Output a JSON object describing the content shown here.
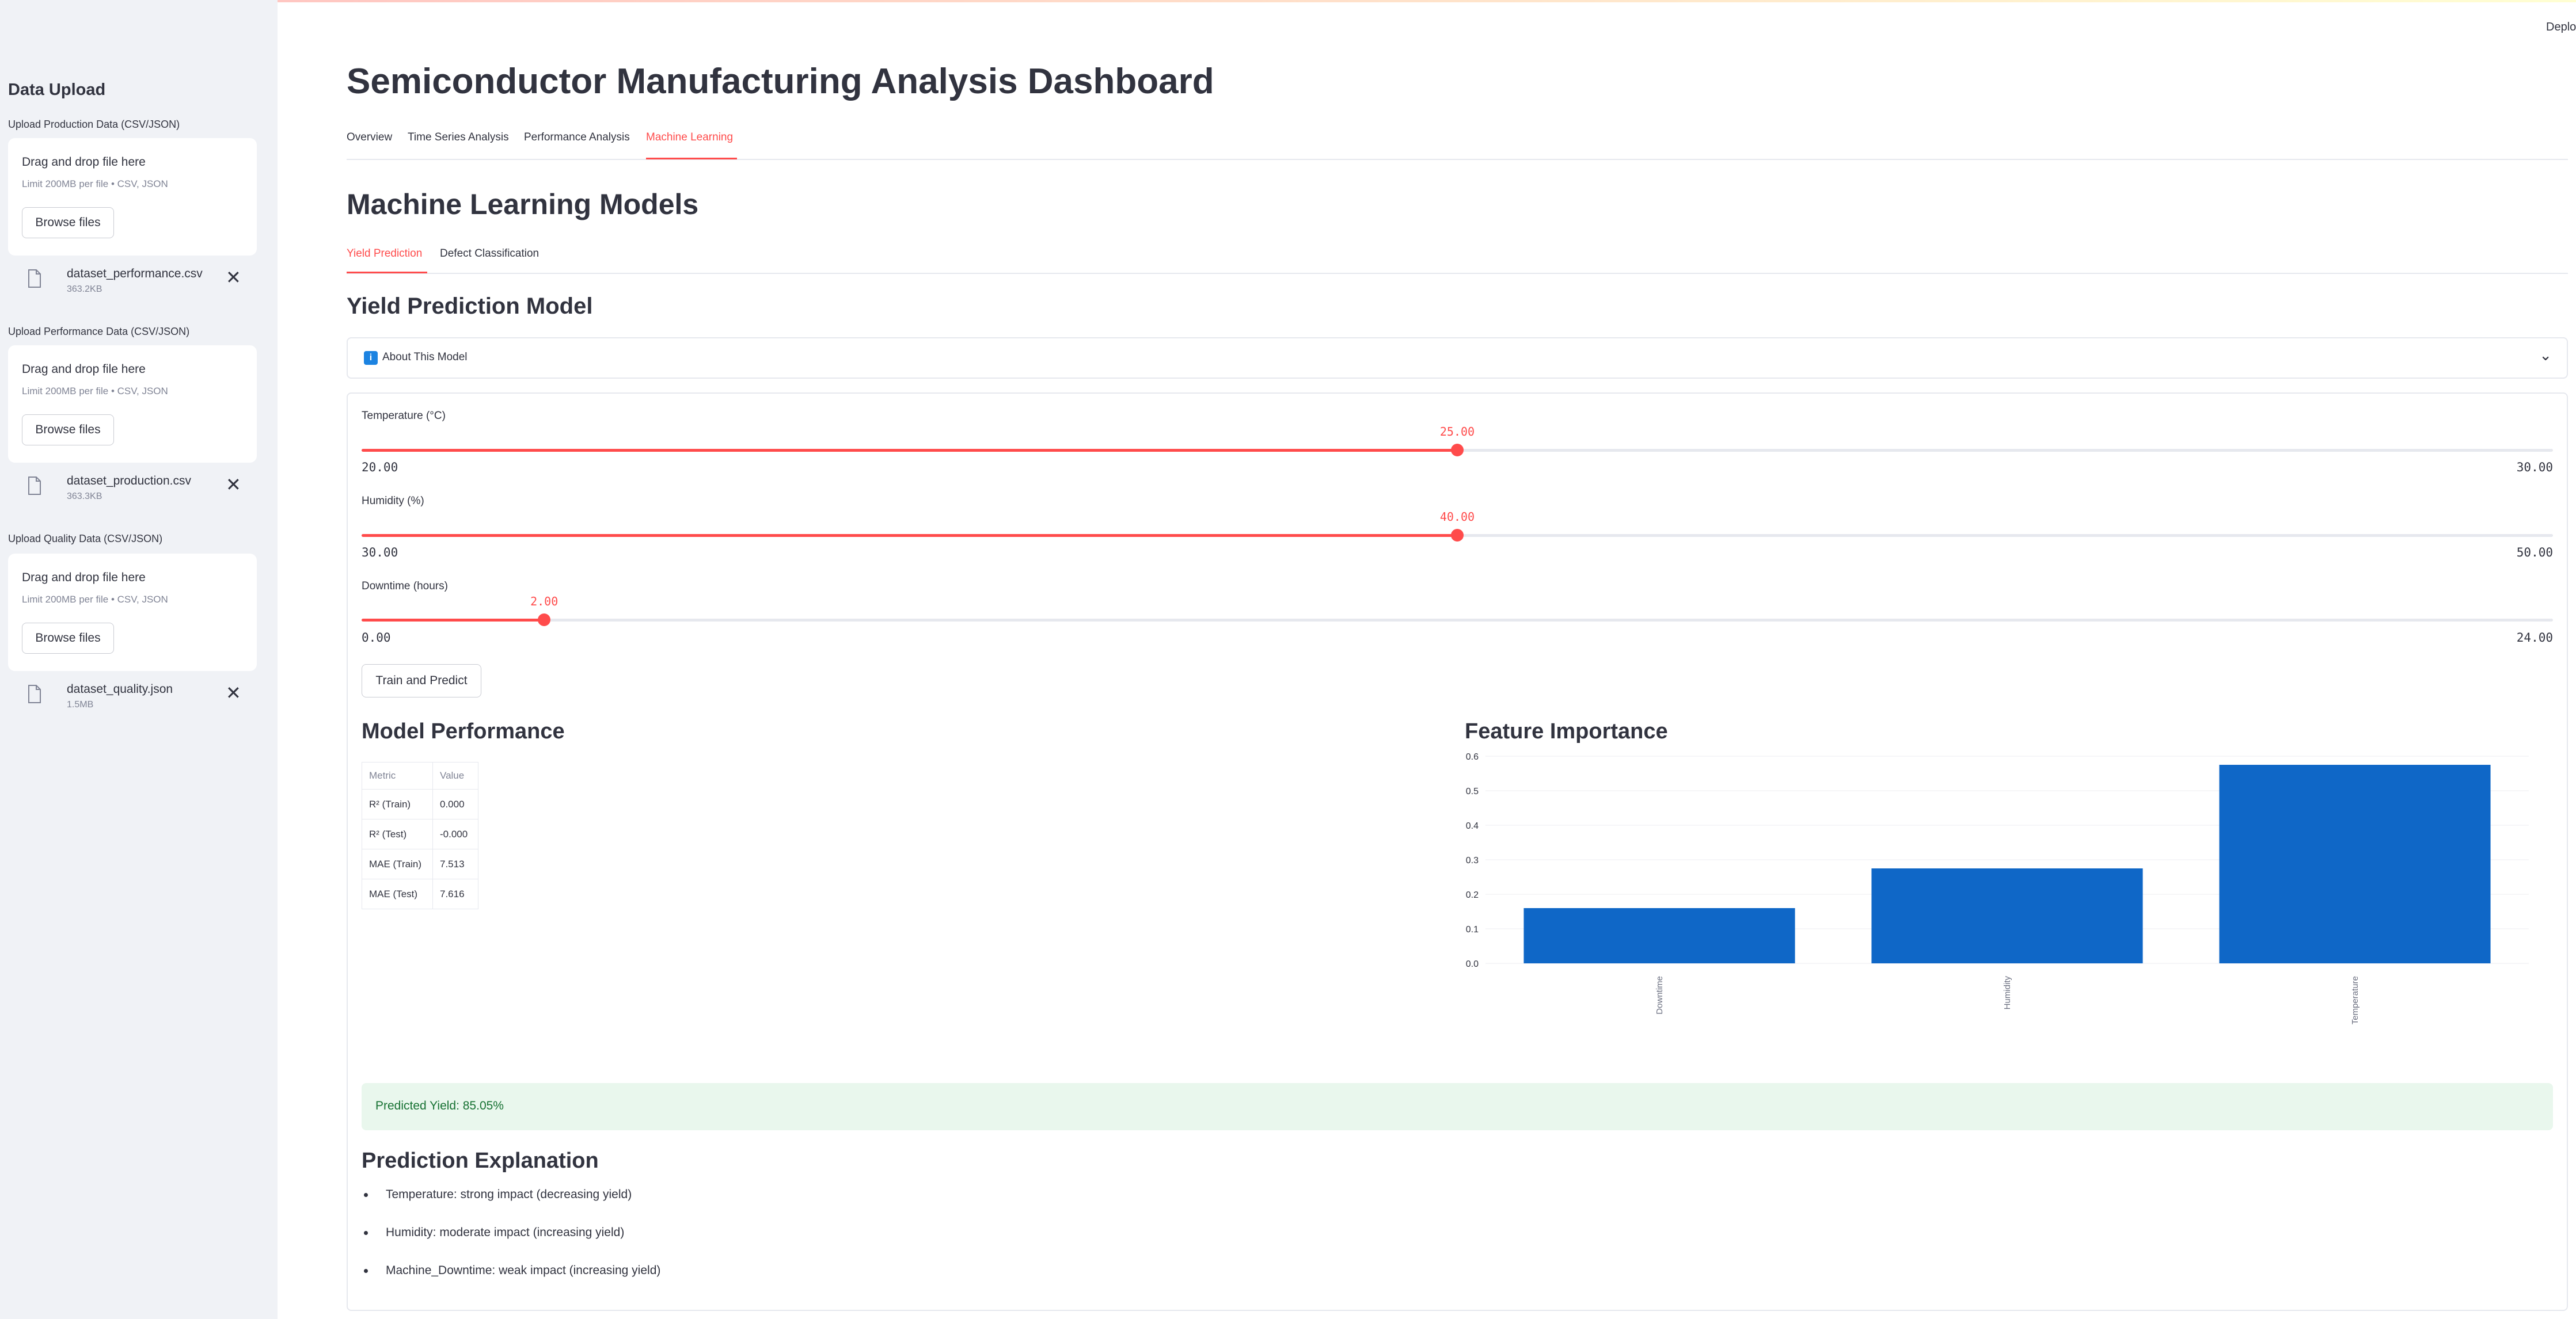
{
  "sidebar": {
    "title": "Data Upload",
    "uploaders": [
      {
        "label": "Upload Production Data (CSV/JSON)",
        "drop_text": "Drag and drop file here",
        "limit": "Limit 200MB per file • CSV, JSON",
        "browse": "Browse files",
        "file_name": "dataset_performance.csv",
        "file_size": "363.2KB"
      },
      {
        "label": "Upload Performance Data (CSV/JSON)",
        "drop_text": "Drag and drop file here",
        "limit": "Limit 200MB per file • CSV, JSON",
        "browse": "Browse files",
        "file_name": "dataset_production.csv",
        "file_size": "363.3KB"
      },
      {
        "label": "Upload Quality Data (CSV/JSON)",
        "drop_text": "Drag and drop file here",
        "limit": "Limit 200MB per file • CSV, JSON",
        "browse": "Browse files",
        "file_name": "dataset_quality.json",
        "file_size": "1.5MB"
      }
    ],
    "remove_icon": "✕"
  },
  "header": {
    "deploy": "Deplo"
  },
  "main": {
    "title": "Semiconductor Manufacturing Analysis Dashboard",
    "tabs": [
      {
        "label": "Overview"
      },
      {
        "label": "Time Series Analysis"
      },
      {
        "label": "Performance Analysis"
      },
      {
        "label": "Machine Learning",
        "active": true
      }
    ],
    "section_title": "Machine Learning Models",
    "subtabs": [
      {
        "label": "Yield Prediction",
        "active": true
      },
      {
        "label": "Defect Classification"
      }
    ],
    "model_title": "Yield Prediction Model",
    "expander": {
      "icon": "info-icon",
      "icon_glyph": "i",
      "label": "About This Model",
      "chevron": "⌄"
    }
  },
  "form": {
    "sliders": [
      {
        "label": "Temperature (°C)",
        "min": 20.0,
        "max": 30.0,
        "value": 25.0,
        "min_text": "20.00",
        "max_text": "30.00",
        "value_text": "25.00"
      },
      {
        "label": "Humidity (%)",
        "min": 30.0,
        "max": 50.0,
        "value": 40.0,
        "min_text": "30.00",
        "max_text": "50.00",
        "value_text": "40.00"
      },
      {
        "label": "Downtime (hours)",
        "min": 0.0,
        "max": 24.0,
        "value": 2.0,
        "min_text": "0.00",
        "max_text": "24.00",
        "value_text": "2.00"
      }
    ],
    "train_button": "Train and Predict",
    "model_performance_title": "Model Performance",
    "metrics": {
      "headers": [
        "Metric",
        "Value"
      ],
      "rows": [
        [
          "R² (Train)",
          "0.000"
        ],
        [
          "R² (Test)",
          "-0.000"
        ],
        [
          "MAE (Train)",
          "7.513"
        ],
        [
          "MAE (Test)",
          "7.616"
        ]
      ]
    },
    "feature_importance_title": "Feature Importance",
    "prediction": "Predicted Yield: 85.05%",
    "explanation_title": "Prediction Explanation",
    "explanations": [
      "Temperature: strong impact (decreasing yield)",
      "Humidity: moderate impact (increasing yield)",
      "Machine_Downtime: weak impact (increasing yield)"
    ]
  },
  "colors": {
    "accent": "#ff4b4b",
    "bar": "#0f67c7",
    "success_bg": "#e9f7ed",
    "success_text": "#177233",
    "sidebar_bg": "#f0f2f6"
  },
  "chart_data": {
    "type": "bar",
    "title": "",
    "xlabel": "",
    "ylabel": "",
    "categories": [
      "Downtime",
      "Humidity",
      "Temperature"
    ],
    "values": [
      0.16,
      0.275,
      0.575
    ],
    "ylim": [
      0,
      0.6
    ],
    "yticks": [
      "0.0",
      "0.1",
      "0.2",
      "0.3",
      "0.4",
      "0.5",
      "0.6"
    ],
    "grid": true,
    "legend": "none"
  }
}
